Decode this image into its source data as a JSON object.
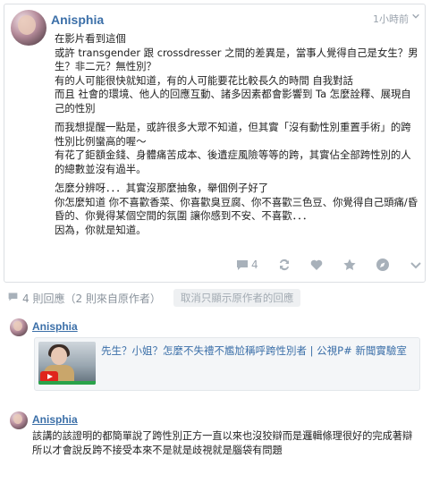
{
  "post": {
    "author": "Anisphia",
    "timestamp": "1小時前",
    "paragraphs": [
      "在影片看到這個\n或許 transgender 跟 crossdresser 之間的差異是，當事人覺得自己是女生？男生？非二元？無性別？\n有的人可能很快就知道，有的人可能要花比較長久的時間 自我對話\n而且 社會的環境、他人的回應互動、諸多因素都會影響到 Ta 怎麼詮釋、展現自己的性別",
      "而我想提醒一點是，或許很多大眾不知道，但其實「沒有動性別重置手術」的跨性別比例蠻高的喔～\n有花了鉅額金錢、身體痛苦成本、後遺症風險等等的跨，其實佔全部跨性別的人的總數並沒有過半。",
      "怎麼分辨呀．．．其實沒那麼抽象，舉個例子好了\n你怎麼知道 你不喜歡香菜、你喜歡臭豆腐、你不喜歡三色豆、你覺得自己頭痛/昏昏的、你覺得某個空間的氛圍 讓你感到不安、不喜歡．．．\n因為，你就是知道。"
    ],
    "actions": {
      "comment_count": "4"
    }
  },
  "replies_bar": {
    "summary": "4 則回應（2 則來自原作者）",
    "hide_op_label": "取消只顯示原作者的回應"
  },
  "replies": [
    {
      "author": "Anisphia",
      "link_title": "先生？小姐？怎麼不失禮不尷尬稱呼跨性別者 | 公視P# 新聞實驗室"
    },
    {
      "author": "Anisphia",
      "text": "該講的該證明的都簡單說了跨性別正方一直以來也沒狡辯而是邏輯條理很好的完成著辯 所以才會說反跨不接受本來不是就是歧視就是腦袋有問題"
    }
  ],
  "colors": {
    "author_blue": "#3b6fa8",
    "icon_gray": "#a8b1ba",
    "border": "#dcdfe3"
  }
}
